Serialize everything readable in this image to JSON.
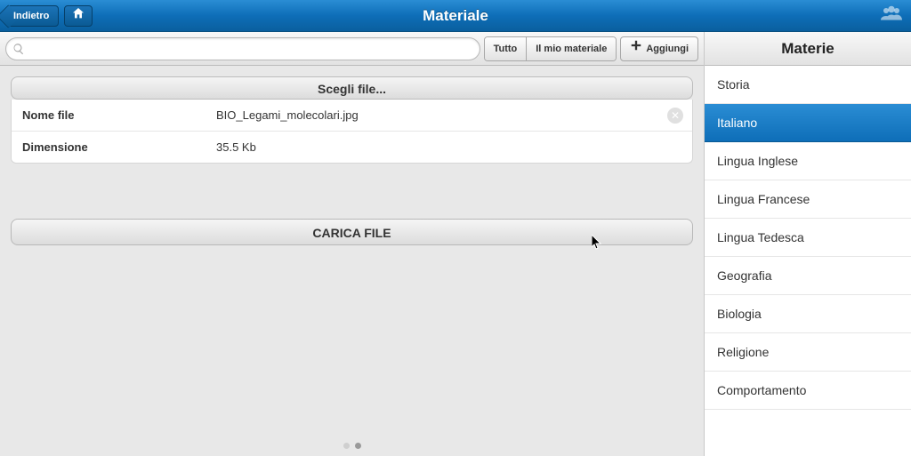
{
  "header": {
    "back_label": "Indietro",
    "title": "Materiale"
  },
  "toolbar": {
    "search_placeholder": "",
    "tab_all": "Tutto",
    "tab_mine": "Il mio materiale",
    "add_label": "Aggiungi"
  },
  "file_panel": {
    "choose_header": "Scegli file...",
    "name_label": "Nome file",
    "name_value": "BIO_Legami_molecolari.jpg",
    "size_label": "Dimensione",
    "size_value": "35.5 Kb",
    "upload_label": "CARICA FILE"
  },
  "sidebar": {
    "title": "Materie",
    "items": [
      {
        "label": "Storia",
        "selected": false
      },
      {
        "label": "Italiano",
        "selected": true
      },
      {
        "label": "Lingua Inglese",
        "selected": false
      },
      {
        "label": "Lingua Francese",
        "selected": false
      },
      {
        "label": "Lingua Tedesca",
        "selected": false
      },
      {
        "label": "Geografia",
        "selected": false
      },
      {
        "label": "Biologia",
        "selected": false
      },
      {
        "label": "Religione",
        "selected": false
      },
      {
        "label": "Comportamento",
        "selected": false
      }
    ]
  },
  "pager": {
    "count": 2,
    "active_index": 1
  }
}
